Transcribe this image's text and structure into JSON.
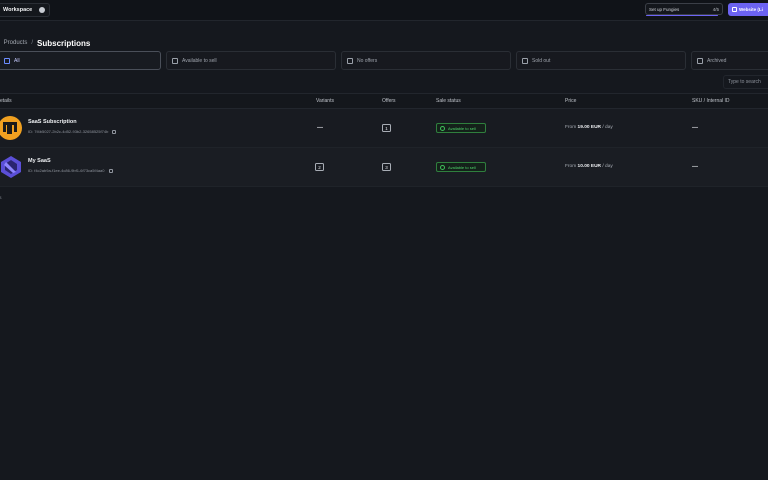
{
  "topbar": {
    "workspace_label": "Workspace",
    "setup_label": "Set up Fungies",
    "setup_count": "4/5",
    "website_button_label": "Website (Li"
  },
  "breadcrumb": {
    "parent": "Products",
    "separator": "/",
    "current": "Subscriptions"
  },
  "filters": [
    {
      "label": "All",
      "active": true
    },
    {
      "label": "Available to sell",
      "active": false
    },
    {
      "label": "No offers",
      "active": false
    },
    {
      "label": "Sold out",
      "active": false
    },
    {
      "label": "Archived",
      "active": false
    }
  ],
  "search": {
    "placeholder": "Type to search"
  },
  "table": {
    "headers": {
      "details": "etails",
      "variants": "Variants",
      "offers": "Offers",
      "sale_status": "Sale status",
      "price": "Price",
      "sku": "SKU / Internal ID"
    },
    "rows": [
      {
        "name": "SaaS Subscription",
        "id": "ID: 7f4b5027-2b2c-4d52-93b2-32658525f74b",
        "variants": "—",
        "offers": "1",
        "status": "Available to sell",
        "price_prefix": "From",
        "price_value": "19.00 EUR",
        "price_suffix": "/ day",
        "sku": "—"
      },
      {
        "name": "My SaaS",
        "id": "ID: f4c2ab9a-f1ee-4c86-9bf1-6f73ca5f4aa0",
        "variants": "2",
        "offers": "3",
        "status": "Available to sell",
        "price_prefix": "From",
        "price_value": "10.00 EUR",
        "price_suffix": "/ day",
        "sku": "—"
      }
    ]
  },
  "footer": {
    "text": "ts"
  },
  "colors": {
    "accent": "#6c63f2",
    "status_green": "#4fd36a",
    "avatar1": "#f0a020",
    "avatar2": "#5b4fd8"
  }
}
